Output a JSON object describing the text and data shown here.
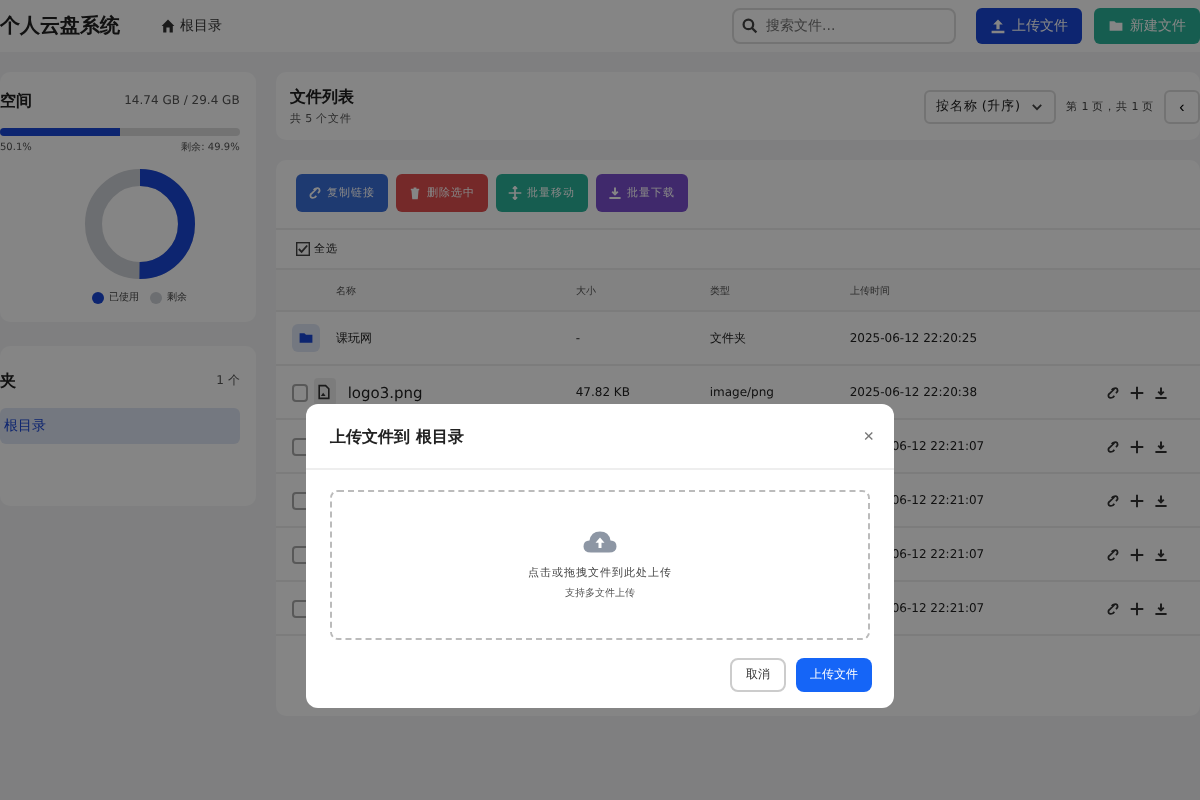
{
  "header": {
    "title": "个人云盘系统",
    "breadcrumb": "根目录",
    "search": {
      "placeholder": "搜索文件..."
    },
    "buttons": [
      {
        "label": "上传文件",
        "kind": "primary"
      },
      {
        "label": "新建文件",
        "kind": "secondary"
      }
    ]
  },
  "storage": {
    "title": "空间",
    "usage": "14.74 GB / 29.4 GB",
    "level": 0.501,
    "used_label": "50.1%",
    "free_label": "剩余: 49.9%",
    "legend": [
      {
        "label": "已使用",
        "kind": "used"
      },
      {
        "label": "剩余",
        "kind": "free"
      }
    ]
  },
  "folders": {
    "title": "夹",
    "count": "1 个",
    "items": [
      {
        "label": "根目录",
        "selected": true
      }
    ]
  },
  "file_list": {
    "title": "文件列表",
    "subtitle": "共 5 个文件",
    "sort": "按名称 (升序)",
    "page_info": "第 1 页，共 1 页"
  },
  "toolbar": [
    {
      "label": "复制链接",
      "kind": "link"
    },
    {
      "label": "删除选中",
      "kind": "delete"
    },
    {
      "label": "批量移动",
      "kind": "move"
    },
    {
      "label": "批量下载",
      "kind": "download"
    }
  ],
  "select_all": "全选",
  "table": {
    "columns": [
      "名称",
      "大小",
      "类型",
      "上传时间"
    ],
    "rows": [
      {
        "kind": "folder",
        "name": "课玩网",
        "size": "-",
        "type": "文件夹",
        "time": "2025-06-12 22:20:25"
      },
      {
        "kind": "file",
        "name": "logo3.png",
        "size": "47.82 KB",
        "type": "image/png",
        "time": "2025-06-12 22:20:38",
        "checked": false
      },
      {
        "kind": "covered",
        "time": "06-12 22:21:07",
        "checked": false
      },
      {
        "kind": "covered",
        "time": "06-12 22:21:07",
        "checked": false
      },
      {
        "kind": "covered",
        "time": "06-12 22:21:07",
        "checked": false
      },
      {
        "kind": "covered",
        "time": "06-12 22:21:07",
        "checked": false
      }
    ]
  },
  "pager": {
    "prev": "‹"
  },
  "modal": {
    "title": "上传文件到 根目录",
    "close": "×",
    "drop_text": "点击或拖拽文件到此处上传",
    "drop_hint": "支持多文件上传",
    "buttons": [
      {
        "label": "取消",
        "kind": "secondary"
      },
      {
        "label": "上传文件",
        "kind": "primary"
      }
    ]
  }
}
